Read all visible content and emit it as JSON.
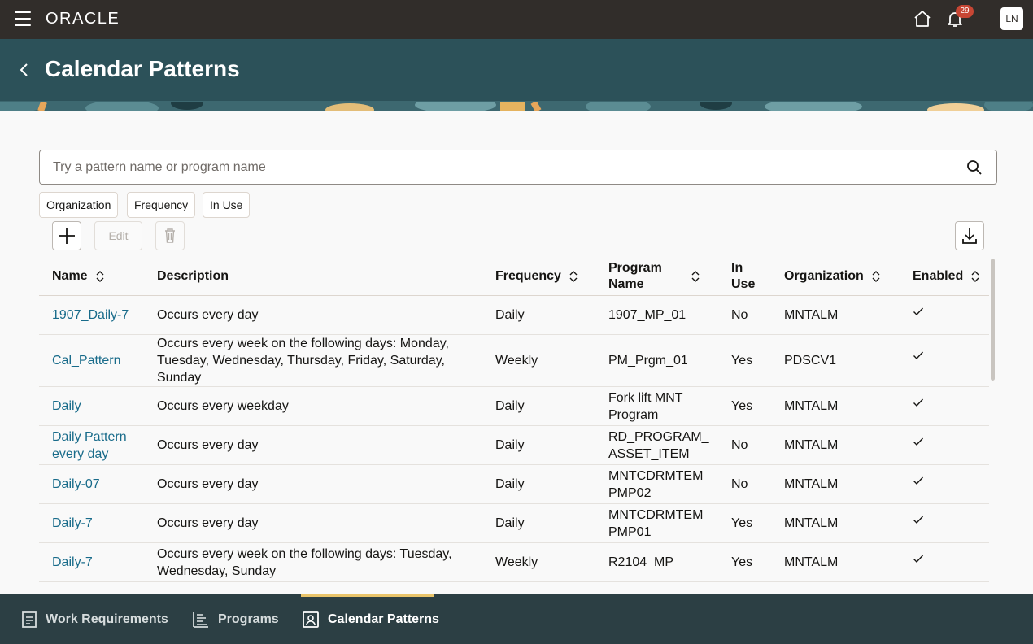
{
  "topbar": {
    "brand": "ORACLE",
    "notification_count": "29",
    "user_initials": "LN"
  },
  "header": {
    "title": "Calendar Patterns"
  },
  "search": {
    "placeholder": "Try a pattern name or program name"
  },
  "filters": [
    "Organization",
    "Frequency",
    "In Use"
  ],
  "toolbar": {
    "edit_label": "Edit"
  },
  "table": {
    "columns": {
      "name": "Name",
      "description": "Description",
      "frequency": "Frequency",
      "program_name": "Program Name",
      "in_use": "In Use",
      "organization": "Organization",
      "enabled": "Enabled"
    },
    "rows": [
      {
        "name": "1907_Daily-7",
        "description": "Occurs every day",
        "frequency": "Daily",
        "program_name": "1907_MP_01",
        "in_use": "No",
        "organization": "MNTALM",
        "enabled": true
      },
      {
        "name": "Cal_Pattern",
        "description": "Occurs every week on the following days: Monday, Tuesday, Wednesday, Thursday, Friday, Saturday, Sunday",
        "frequency": "Weekly",
        "program_name": "PM_Prgm_01",
        "in_use": "Yes",
        "organization": "PDSCV1",
        "enabled": true
      },
      {
        "name": "Daily",
        "description": "Occurs every weekday",
        "frequency": "Daily",
        "program_name": "Fork lift MNT Program",
        "in_use": "Yes",
        "organization": "MNTALM",
        "enabled": true
      },
      {
        "name": "Daily Pattern every day",
        "description": "Occurs every day",
        "frequency": "Daily",
        "program_name": "RD_PROGRAM_ ASSET_ITEM",
        "in_use": "No",
        "organization": "MNTALM",
        "enabled": true
      },
      {
        "name": "Daily-07",
        "description": "Occurs every day",
        "frequency": "Daily",
        "program_name": "MNTCDRMTEM PMP02",
        "in_use": "No",
        "organization": "MNTALM",
        "enabled": true
      },
      {
        "name": "Daily-7",
        "description": "Occurs every day",
        "frequency": "Daily",
        "program_name": "MNTCDRMTEM PMP01",
        "in_use": "Yes",
        "organization": "MNTALM",
        "enabled": true
      },
      {
        "name": "Daily-7",
        "description": "Occurs every week on the following days: Tuesday, Wednesday, Sunday",
        "frequency": "Weekly",
        "program_name": "R2104_MP",
        "in_use": "Yes",
        "organization": "MNTALM",
        "enabled": true
      }
    ]
  },
  "bottom_nav": {
    "items": [
      "Work Requirements",
      "Programs",
      "Calendar Patterns"
    ],
    "active": "Calendar Patterns"
  },
  "colors": {
    "topbar": "#312d2a",
    "header": "#2c5159",
    "link": "#186b8a",
    "badge": "#c74634",
    "nav": "#2c3f44",
    "nav_indicator": "#e9c46a"
  }
}
